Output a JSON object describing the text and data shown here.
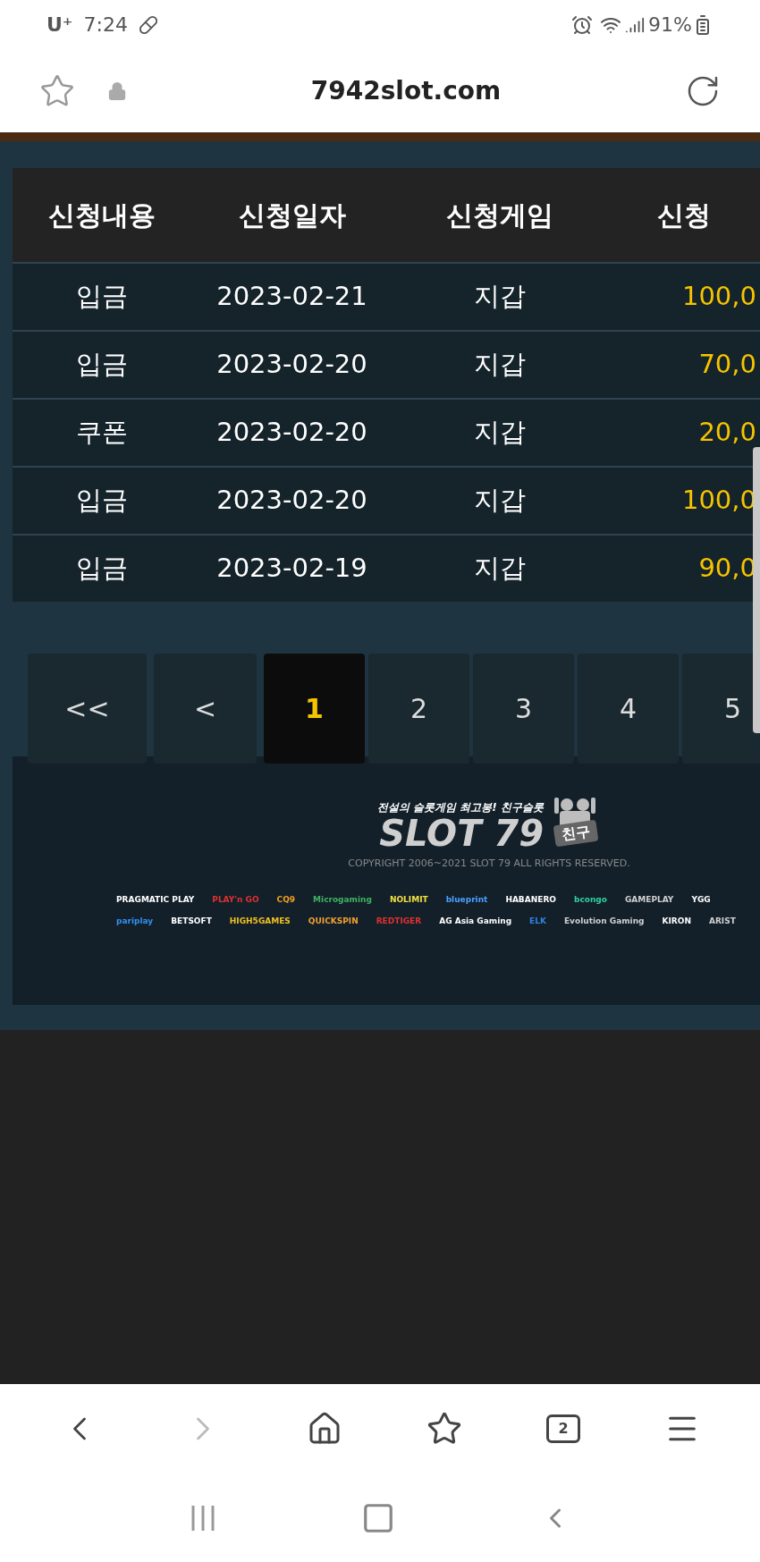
{
  "status_bar": {
    "carrier": "U⁺",
    "time": "7:24",
    "battery": "91%"
  },
  "address_bar": {
    "url": "7942slot.com"
  },
  "table": {
    "columns": [
      "신청내용",
      "신청일자",
      "신청게임",
      "신청"
    ],
    "rows": [
      {
        "cells": [
          "입금",
          "2023-02-21",
          "지갑",
          "100,0"
        ]
      },
      {
        "cells": [
          "입금",
          "2023-02-20",
          "지갑",
          "70,0"
        ]
      },
      {
        "cells": [
          "쿠폰",
          "2023-02-20",
          "지갑",
          "20,0"
        ]
      },
      {
        "cells": [
          "입금",
          "2023-02-20",
          "지갑",
          "100,0"
        ]
      },
      {
        "cells": [
          "입금",
          "2023-02-19",
          "지갑",
          "90,0"
        ]
      }
    ]
  },
  "pagination": [
    {
      "label": "<<",
      "selected": false
    },
    {
      "label": "<",
      "selected": false
    },
    {
      "label": "1",
      "selected": true
    },
    {
      "label": "2",
      "selected": false
    },
    {
      "label": "3",
      "selected": false
    },
    {
      "label": "4",
      "selected": false
    },
    {
      "label": "5",
      "selected": false
    }
  ],
  "footer": {
    "tagline": "전설의 슬롯게임 최고봉! 친구슬롯",
    "logo": "SLOT 79",
    "badge": "친구",
    "copyright": "COPYRIGHT  2006~2021 SLOT 79 ALL RIGHTS RESERVED.",
    "providers": [
      [
        {
          "name": "PRAGMATIC PLAY",
          "color": "#ffffff"
        },
        {
          "name": "PLAY'n GO",
          "color": "#e03030"
        },
        {
          "name": "CQ9",
          "color": "#f0a020"
        },
        {
          "name": "Microgaming",
          "color": "#40b060"
        },
        {
          "name": "NOLIMIT",
          "color": "#f0e040"
        },
        {
          "name": "blueprint",
          "color": "#4aa0ff"
        },
        {
          "name": "HABANERO",
          "color": "#ffffff"
        },
        {
          "name": "bcongo",
          "color": "#30d0a0"
        },
        {
          "name": "GAMEPLAY",
          "color": "#d0d0d0"
        },
        {
          "name": "YGG",
          "color": "#ffffff"
        }
      ],
      [
        {
          "name": "pariplay",
          "color": "#3090f0"
        },
        {
          "name": "BETSOFT",
          "color": "#ffffff"
        },
        {
          "name": "HIGH5GAMES",
          "color": "#f0c020"
        },
        {
          "name": "QUICKSPIN",
          "color": "#f0a030"
        },
        {
          "name": "REDTIGER",
          "color": "#e03030"
        },
        {
          "name": "AG Asia Gaming",
          "color": "#ffffff"
        },
        {
          "name": "ELK",
          "color": "#3080e0"
        },
        {
          "name": "Evolution Gaming",
          "color": "#d0d0d0"
        },
        {
          "name": "KIRON",
          "color": "#ffffff"
        },
        {
          "name": "ARIST",
          "color": "#d0d0d0"
        }
      ]
    ]
  },
  "nav_bar": {
    "tab_count": "2",
    "forward_disabled": true
  }
}
